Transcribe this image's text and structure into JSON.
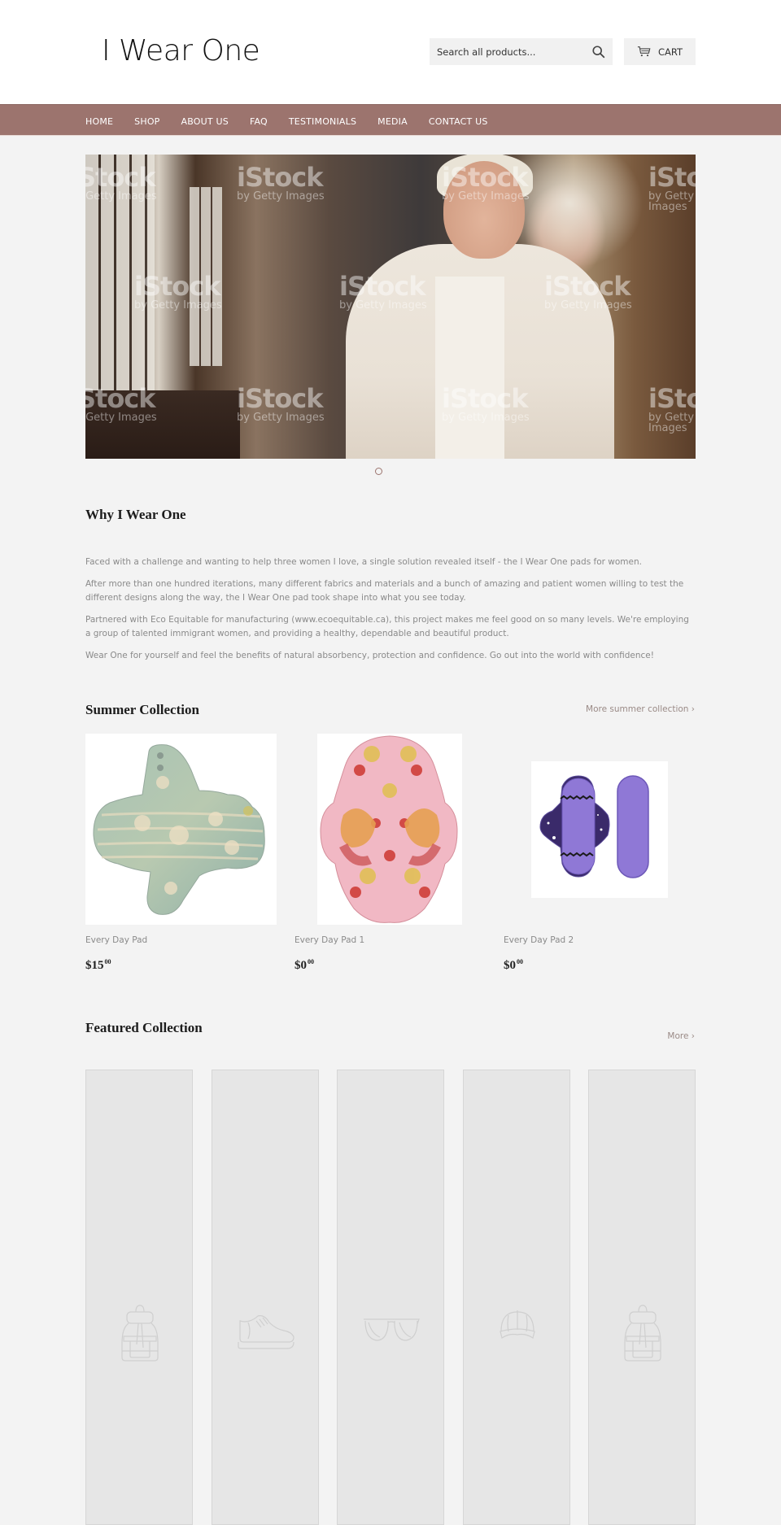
{
  "header": {
    "logo_text": "I Wear One",
    "search": {
      "placeholder": "Search all products...",
      "value": ""
    },
    "cart_label": "CART"
  },
  "nav": {
    "items": [
      {
        "label": "HOME"
      },
      {
        "label": "SHOP"
      },
      {
        "label": "ABOUT US"
      },
      {
        "label": "FAQ"
      },
      {
        "label": "TESTIMONIALS"
      },
      {
        "label": "MEDIA"
      },
      {
        "label": "CONTACT US"
      }
    ]
  },
  "hero": {
    "watermark_brand": "iStock",
    "watermark_sub": "by Getty Images",
    "slide_count": 1,
    "active_slide": 1
  },
  "why": {
    "title": "Why I Wear One",
    "paragraphs": [
      "Faced with a challenge and wanting to help three women I love, a single solution revealed itself - the I Wear One pads for women.",
      "After more than one hundred iterations, many different fabrics and materials and a bunch of amazing and patient women willing to test the different designs along the way, the I Wear One pad took shape into what you see today.",
      "Partnered with Eco Equitable for manufacturing (www.ecoequitable.ca), this project makes me feel good on so many levels. We're employing a group of talented immigrant women, and providing a healthy, dependable and beautiful product.",
      "Wear One for yourself and feel the benefits of natural absorbency, protection and confidence. Go out into the world with confidence!"
    ]
  },
  "summer": {
    "title": "Summer Collection",
    "more_label": "More summer collection ›",
    "products": [
      {
        "name": "Every Day Pad",
        "price_main": "$15",
        "price_cents": "00",
        "image": "teal-floral-pad"
      },
      {
        "name": "Every Day Pad 1",
        "price_main": "$0",
        "price_cents": "00",
        "image": "pink-squirrel-pad"
      },
      {
        "name": "Every Day Pad 2",
        "price_main": "$0",
        "price_cents": "00",
        "image": "purple-pad-set"
      }
    ]
  },
  "featured": {
    "title": "Featured Collection",
    "more_label": "More ›",
    "placeholders": [
      {
        "icon": "backpack-icon"
      },
      {
        "icon": "sneaker-icon"
      },
      {
        "icon": "sunglasses-icon"
      },
      {
        "icon": "cap-icon"
      },
      {
        "icon": "backpack-icon"
      }
    ]
  },
  "colors": {
    "nav_bg": "#9c746e",
    "page_bg": "#f3f3f3",
    "header_bg": "#ffffff",
    "placeholder_bg": "#e6e6e6"
  }
}
